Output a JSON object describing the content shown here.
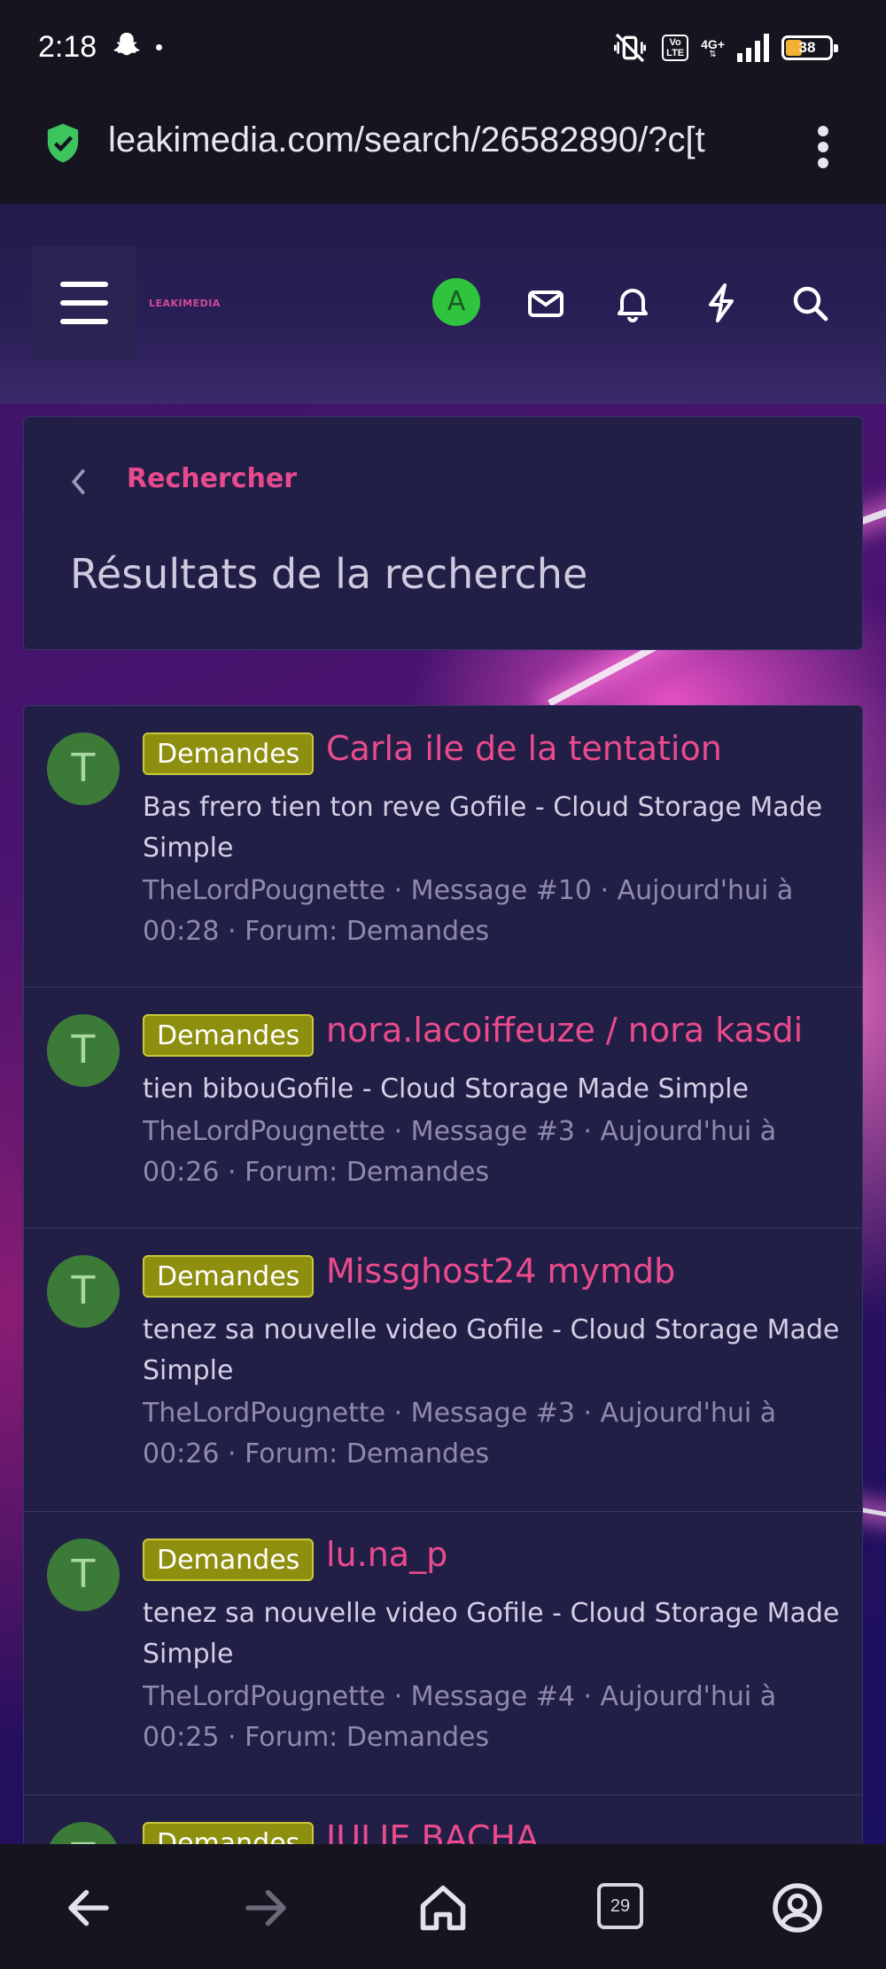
{
  "status_bar": {
    "time": "2:18",
    "volte": "Vo\nLTE",
    "network": "4G+",
    "battery": "38",
    "battery_level": 0.38
  },
  "browser": {
    "url": "leakimedia.com/search/26582890/?c[t"
  },
  "header": {
    "logo": "LEAKIMEDIA",
    "user_initial": "A"
  },
  "breadcrumb": {
    "label": "Rechercher"
  },
  "page_title": "Résultats de la recherche",
  "results": [
    {
      "avatar": "T",
      "tag": "Demandes",
      "title": "Carla ile de la tentation",
      "snippet": "Bas frero tien ton reve Gofile - Cloud Storage Made Simple",
      "meta": "TheLordPougnette · Message #10 · Aujourd'hui à 00:28 · Forum: Demandes"
    },
    {
      "avatar": "T",
      "tag": "Demandes",
      "title": "nora.lacoiffeuze / nora kasdi",
      "snippet": "tien bibouGofile - Cloud Storage Made Simple",
      "meta": "TheLordPougnette · Message #3 · Aujourd'hui à 00:26 · Forum: Demandes"
    },
    {
      "avatar": "T",
      "tag": "Demandes",
      "title": "Missghost24 mymdb",
      "snippet": "tenez sa nouvelle video Gofile - Cloud Storage Made Simple",
      "meta": "TheLordPougnette · Message #3 · Aujourd'hui à 00:26 · Forum: Demandes"
    },
    {
      "avatar": "T",
      "tag": "Demandes",
      "title": "lu.na_p",
      "snippet": "tenez sa nouvelle video Gofile - Cloud Storage Made Simple",
      "meta": "TheLordPougnette · Message #4 · Aujourd'hui à 00:25 · Forum: Demandes"
    },
    {
      "avatar": "T",
      "tag": "Demandes",
      "title": "JULIE BACHA",
      "snippet": "",
      "meta": ""
    }
  ],
  "bottom_nav": {
    "tabs_count": "29"
  },
  "colors": {
    "accent": "#ea4b8c",
    "tag_bg": "#8f8f0f",
    "card_bg": "#221f47",
    "avatar_green": "#3c7a38"
  }
}
